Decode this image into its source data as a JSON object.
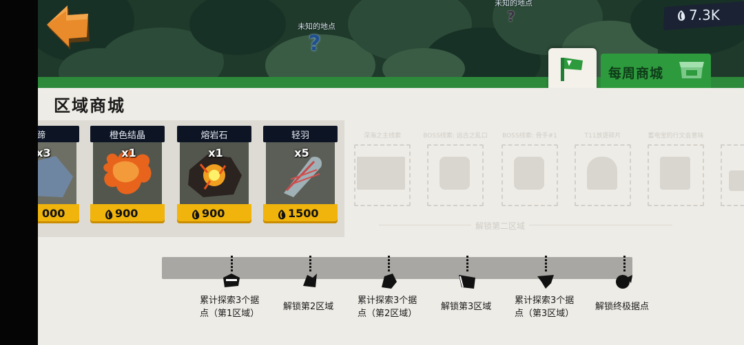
{
  "map": {
    "markers": [
      {
        "label": "未知的地点"
      },
      {
        "label": "未知的地点"
      }
    ]
  },
  "currency": {
    "icon": "gem-icon",
    "value": "7.3K"
  },
  "tabs": {
    "region_shop_icon": "flag-icon",
    "weekly_shop_label": "每周商城",
    "weekly_shop_icon": "shop-icon"
  },
  "panel": {
    "title": "区域商城"
  },
  "items": [
    {
      "name": "怪蹄",
      "qty": "x3",
      "price": "000"
    },
    {
      "name": "橙色结晶",
      "qty": "x1",
      "price": "900"
    },
    {
      "name": "熔岩石",
      "qty": "x1",
      "price": "900"
    },
    {
      "name": "轻羽",
      "qty": "x5",
      "price": "1500"
    }
  ],
  "locked_items": [
    {
      "name": "深海之主线索"
    },
    {
      "name": "BOSS线索: 远古之乱口"
    },
    {
      "name": "BOSS线索: 骨手#1"
    },
    {
      "name": "T11放逐碎片"
    },
    {
      "name": "蓄电宝的行文会意味"
    },
    {
      "name": ""
    }
  ],
  "unlock_note": "解锁第二区域",
  "milestones": [
    {
      "label": "累计探索3个据点（第1区域）"
    },
    {
      "label": "解锁第2区域"
    },
    {
      "label": "累计探索3个据点（第2区域）"
    },
    {
      "label": "解锁第3区域"
    },
    {
      "label": "累计探索3个据点（第3区域）"
    },
    {
      "label": "解锁终极据点"
    }
  ],
  "colors": {
    "accent_green": "#2e9a3e",
    "price_yellow": "#f0b40c",
    "panel_bg": "#eeece6"
  }
}
